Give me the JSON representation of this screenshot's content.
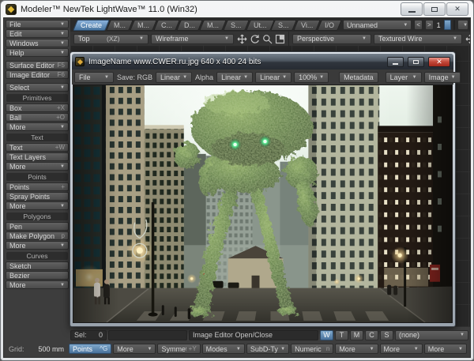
{
  "window": {
    "title": "Modeler™ NewTek LightWave™ 11.0 (Win32)"
  },
  "icons": {
    "dropdown": "▼",
    "prev": "<",
    "next": ">",
    "close": "✕"
  },
  "colors": {
    "accent_blue": "#5d8ab5",
    "close_red": "#c0392b",
    "eye_green": "#57e890"
  },
  "menubar": {
    "tabs": [
      "Create",
      "M...",
      "M...",
      "C...",
      "D...",
      "M...",
      "S...",
      "Ut...",
      "S...",
      "Vi...",
      "I/O"
    ],
    "active_tab": "Create",
    "object_selector": "Unnamed",
    "layer_number": "1"
  },
  "viewport_toolbar": {
    "left_view": "Top",
    "left_axis": "(XZ)",
    "left_mode": "Wireframe",
    "right_view": "Perspective",
    "right_mode": "Textured Wire"
  },
  "sidebar": {
    "menus": [
      "File",
      "Edit",
      "Windows",
      "Help"
    ],
    "editors": [
      {
        "label": "Surface Editor",
        "shortcut": "F5"
      },
      {
        "label": "Image Editor",
        "shortcut": "F6"
      }
    ],
    "select_label": "Select",
    "groups": [
      {
        "title": "Primitives",
        "items": [
          {
            "label": "Box",
            "suffix": "+X"
          },
          {
            "label": "Ball",
            "suffix": "+O"
          },
          {
            "label": "More",
            "suffix": "▼"
          }
        ]
      },
      {
        "title": "Text",
        "items": [
          {
            "label": "Text",
            "suffix": "+W"
          },
          {
            "label": "Text Layers",
            "suffix": ""
          },
          {
            "label": "More",
            "suffix": "▼"
          }
        ]
      },
      {
        "title": "Points",
        "items": [
          {
            "label": "Points",
            "suffix": "+"
          },
          {
            "label": "Spray Points",
            "suffix": ""
          },
          {
            "label": "More",
            "suffix": "▼"
          }
        ]
      },
      {
        "title": "Polygons",
        "items": [
          {
            "label": "Pen",
            "suffix": ""
          },
          {
            "label": "Make Polygon",
            "suffix": "p"
          },
          {
            "label": "More",
            "suffix": "▼"
          }
        ]
      },
      {
        "title": "Curves",
        "items": [
          {
            "label": "Sketch",
            "suffix": ""
          },
          {
            "label": "Bezier",
            "suffix": ""
          },
          {
            "label": "More",
            "suffix": "▼"
          }
        ]
      }
    ]
  },
  "image_editor": {
    "title": "ImageName www.CWER.ru.jpg 640 x 400 24 bits",
    "toolbar": {
      "file": "File",
      "save": "Save: RGB",
      "save_colorspace": "Linear",
      "alpha": "Alpha",
      "alpha_colorspace": "Linear",
      "display_colorspace": "Linear",
      "zoom": "100%",
      "metadata": "Metadata",
      "layer": "Layer",
      "image": "Image"
    }
  },
  "statusbar": {
    "sel_label": "Sel:",
    "sel_value": "0",
    "action": "Image Editor Open/Close",
    "toggles": [
      "W",
      "T",
      "M",
      "C",
      "S"
    ],
    "active_toggle": "W",
    "preset": "(none)"
  },
  "bottombar": {
    "grid_label": "Grid:",
    "grid_value": "500 mm",
    "buttons": [
      {
        "label": "Points",
        "suffix": "^G"
      },
      {
        "label": "More",
        "suffix": "▼"
      },
      {
        "label": "Symmetry",
        "suffix": "+Y"
      },
      {
        "label": "Modes",
        "suffix": "▼"
      },
      {
        "label": "SubD-Type",
        "suffix": "▼"
      },
      {
        "label": "Numeric",
        "suffix": "n"
      },
      {
        "label": "More",
        "suffix": "▼"
      },
      {
        "label": "More",
        "suffix": "▼"
      },
      {
        "label": "More",
        "suffix": "▼"
      }
    ]
  }
}
